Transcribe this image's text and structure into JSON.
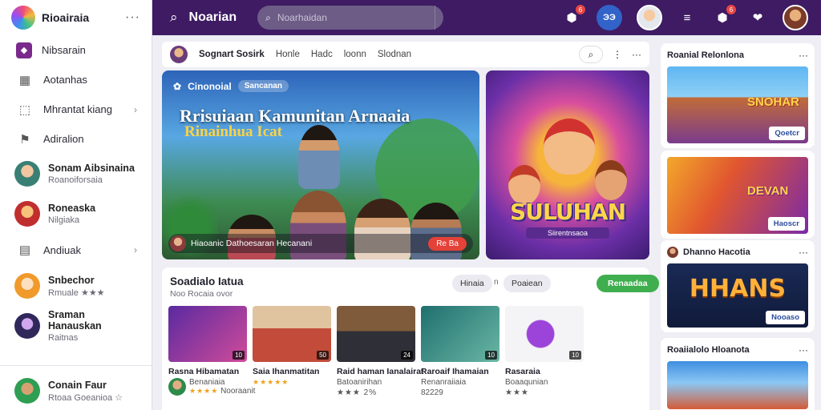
{
  "sidebar": {
    "title": "Rioairaia",
    "items": [
      {
        "label": "Nibsarain",
        "icon": "community-icon",
        "active": true,
        "chevron": false
      },
      {
        "label": "Aotanhas",
        "icon": "calendar-icon",
        "active": false,
        "chevron": false
      },
      {
        "label": "Mhrantat kiang",
        "icon": "box-icon",
        "active": false,
        "chevron": true
      },
      {
        "label": "Adiralion",
        "icon": "flag-icon",
        "active": false,
        "chevron": false
      }
    ],
    "users": [
      {
        "name": "Sonam Aibsinaina",
        "sub": "Roanoiforsaia"
      },
      {
        "name": "Roneaska",
        "sub": "Nilgiaka"
      }
    ],
    "item5": {
      "label": "Andiuak",
      "icon": "document-icon",
      "chevron": true
    },
    "users2": [
      {
        "name": "Snbechor",
        "sub": "Rmuale ★★★"
      },
      {
        "name": "Sraman Hanauskan",
        "sub": "Raitnas"
      }
    ],
    "footer_user": {
      "name": "Conain Faur",
      "sub": "Rtoaa Goeanioa ☆"
    }
  },
  "topbar": {
    "title": "Noarian",
    "search_placeholder": "Noarhaidan",
    "notif_count": "6",
    "round_label": "ЭЭ",
    "badge2": "6"
  },
  "feed": {
    "author": "Sognart Sosirk",
    "tabs": [
      "Honle",
      "Hadc",
      "loonn",
      "Slodnan"
    ]
  },
  "hero": {
    "channel": "Cinonoial",
    "pill": "Sancanan",
    "title": "Rrisuiaan Kamunitan Arnaaia",
    "subtitle": "Rinainhua Icat",
    "caption": "Hiaoanic Dathoesaran Hecanani",
    "live_label": "Re Ba"
  },
  "poster": {
    "title": "SULUHAN",
    "sub": "Siirentnsaoa"
  },
  "section": {
    "title": "Soadialo Iatua",
    "sub": "Noo Rocaia ovor",
    "chip1": "Hinaia",
    "chip2": "Poaiean",
    "dot_label": "n",
    "button": "Renaadaa",
    "thumbs": [
      {
        "title": "Rasna Hibamatan",
        "sub": "Benaniaia",
        "rating": "★★★★",
        "dur": "10",
        "has_avatar": true,
        "line2": "Nooraanit"
      },
      {
        "title": "Saia Ihanmatitan",
        "sub": "★★★★★",
        "rating": "",
        "dur": "50",
        "has_avatar": false,
        "line2": ""
      },
      {
        "title": "Raid haman Ianalairat",
        "sub": "Batoanirihan",
        "rating": "★★★ 2%",
        "dur": "24",
        "has_avatar": false,
        "line2": ""
      },
      {
        "title": "Raroaif Ihamaian",
        "sub": "Renanraiiaia",
        "rating": "82229",
        "dur": "10",
        "has_avatar": false,
        "line2": ""
      },
      {
        "title": "Rasaraia",
        "sub": "Boaaqunian",
        "rating": "★★★",
        "dur": "10",
        "has_avatar": false,
        "line2": ""
      }
    ]
  },
  "rail": [
    {
      "title": "Roanial Relonlona",
      "button": "Qoetcr",
      "art_text": "SNOHAR"
    },
    {
      "title": "",
      "button": "Haoscr",
      "art_text": "DEVAN"
    },
    {
      "title": "Dhanno Hacotia",
      "button": "Nooaso",
      "art_text": "HHANS"
    },
    {
      "title": "Roaiialolo Hloanota",
      "button": "",
      "art_text": ""
    }
  ]
}
